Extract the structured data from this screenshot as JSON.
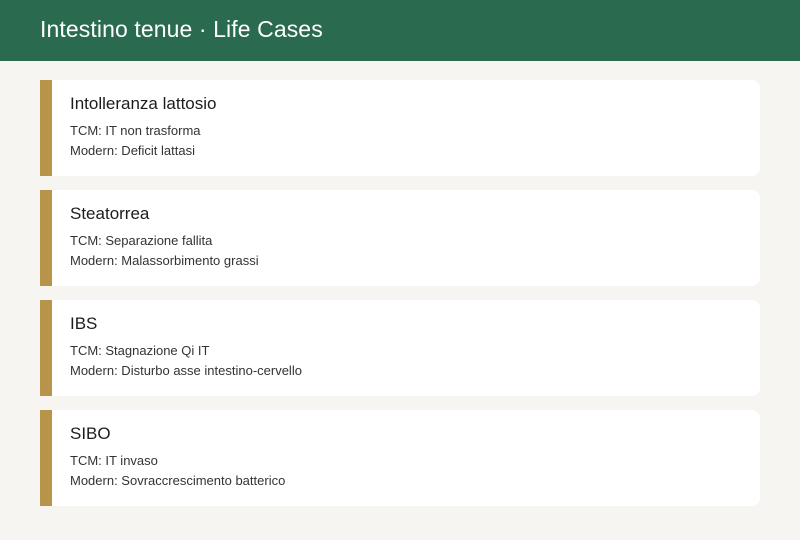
{
  "header": {
    "title": "Intestino tenue · Life Cases"
  },
  "colors": {
    "header_bg": "#2a6b50",
    "accent": "#b8944a",
    "page_bg": "#f6f5f1",
    "card_bg": "#ffffff"
  },
  "cases": [
    {
      "title": "Intolleranza lattosio",
      "tcm": "TCM: IT non trasforma",
      "modern": "Modern: Deficit lattasi"
    },
    {
      "title": "Steatorrea",
      "tcm": "TCM: Separazione fallita",
      "modern": "Modern: Malassorbimento grassi"
    },
    {
      "title": "IBS",
      "tcm": "TCM: Stagnazione Qi IT",
      "modern": "Modern: Disturbo asse intestino-cervello"
    },
    {
      "title": "SIBO",
      "tcm": "TCM: IT invaso",
      "modern": "Modern: Sovraccrescimento batterico"
    }
  ]
}
